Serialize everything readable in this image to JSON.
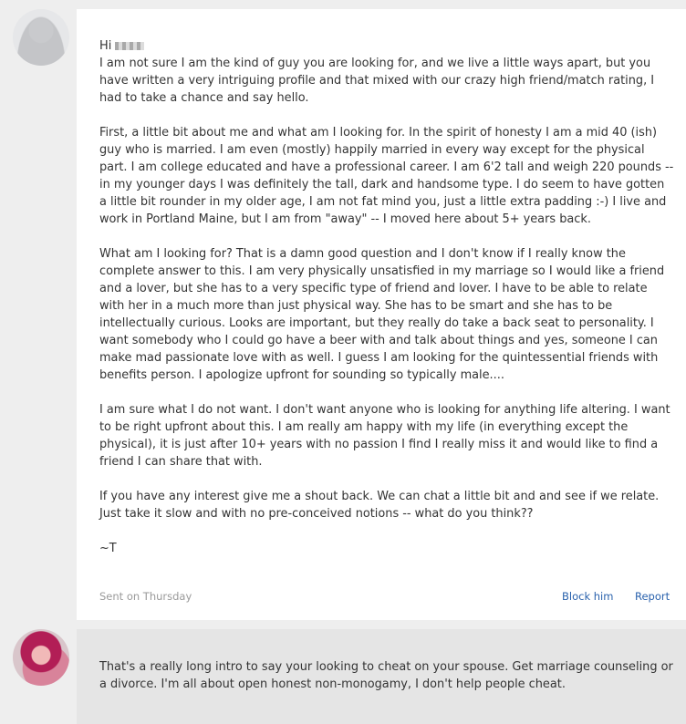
{
  "message": {
    "greeting": "Hi",
    "paragraphs": [
      "I am not sure I am the kind of guy you are looking for, and we live a little ways apart, but you have written a very intriguing profile and that mixed with our crazy high friend/match rating, I had to take a chance and say hello.",
      "First, a little bit about me and what am I looking for. In the spirit of honesty I am a mid 40 (ish) guy who is married. I am even (mostly) happily married in every way except for the physical part. I am college educated and have a professional career. I am 6'2 tall and weigh 220 pounds -- in my younger days I was definitely the tall, dark and handsome type. I do seem to have gotten a little bit rounder in my older age, I am not fat mind you, just a little extra padding :-) I live and work in Portland Maine, but I am from \"away\" -- I moved here about 5+ years back.",
      "What am I looking for? That is a damn good question and I don't know if I really know the complete answer to this. I am very physically unsatisfied in my marriage so I would like a friend and a lover, but she has to a very specific type of friend and lover. I have to be able to relate with her in a much more than just physical way. She has to be smart and she has to be intellectually curious. Looks are important, but they really do take a back seat to personality. I want somebody who I could go have a beer with and talk about things and yes, someone I can make mad passionate love with as well. I guess I am looking for the quintessential friends with benefits person. I apologize upfront for sounding so typically male....",
      "I am sure what I do not want. I don't want anyone who is looking for anything life altering. I want to be right upfront about this. I am really am happy with my life (in everything except the physical), it is just after 10+ years with no passion I find I really miss it and would like to find a friend I can share that with.",
      "If you have any interest give me a shout back. We can chat a little bit and and see if we relate. Just take it slow and with no pre-conceived notions -- what do you think??",
      "~T"
    ],
    "sent_label": "Sent on Thursday",
    "block_label": "Block him",
    "report_label": "Report"
  },
  "reply": {
    "text": "That's a really long intro to say your looking to cheat on your spouse. Get marriage counseling or a divorce. I'm all about open honest non-monogamy, I don't help people cheat."
  },
  "colors": {
    "page_bg": "#eeeeee",
    "card_bg": "#ffffff",
    "reply_bg": "#e5e5e5",
    "text": "#333333",
    "muted": "#9a9a9a",
    "link": "#2a62ad"
  },
  "icons": {
    "sender_avatar": "avatar-placeholder-icon",
    "reply_avatar": "user-avatar"
  }
}
